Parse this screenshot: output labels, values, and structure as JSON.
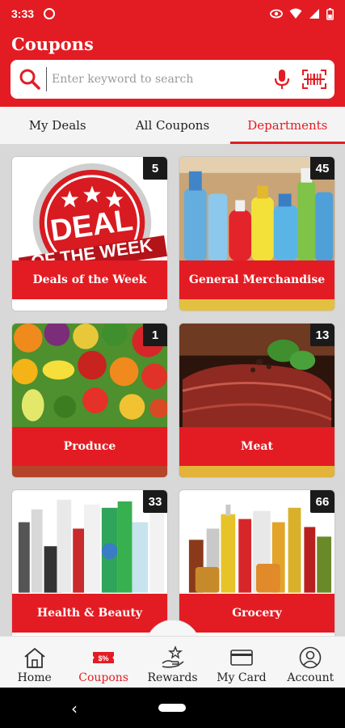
{
  "status_bar": {
    "time": "3:33",
    "notif_badge": "⦿"
  },
  "header": {
    "title": "Coupons"
  },
  "search": {
    "placeholder": "Enter keyword to search"
  },
  "tabs": [
    {
      "label": "My Deals",
      "active": false
    },
    {
      "label": "All Coupons",
      "active": false
    },
    {
      "label": "Departments",
      "active": true
    }
  ],
  "tiles": [
    {
      "label": "Deals of the Week",
      "count": "5",
      "art_text_1": "DEAL",
      "art_text_2": "OF THE WEEK"
    },
    {
      "label": "General Merchandise",
      "count": "45"
    },
    {
      "label": "Produce",
      "count": "1"
    },
    {
      "label": "Meat",
      "count": "13"
    },
    {
      "label": "Health & Beauty",
      "count": "33"
    },
    {
      "label": "Grocery",
      "count": "66"
    }
  ],
  "bottom_nav": [
    {
      "label": "Home",
      "icon": "home-icon",
      "active": false
    },
    {
      "label": "Coupons",
      "icon": "coupon-icon",
      "active": true,
      "icon_text": "$%"
    },
    {
      "label": "Rewards",
      "icon": "rewards-icon",
      "active": false
    },
    {
      "label": "My Card",
      "icon": "card-icon",
      "active": false
    },
    {
      "label": "Account",
      "icon": "account-icon",
      "active": false
    }
  ],
  "colors": {
    "brand": "#e31c23",
    "badge": "#1a1a1a"
  }
}
